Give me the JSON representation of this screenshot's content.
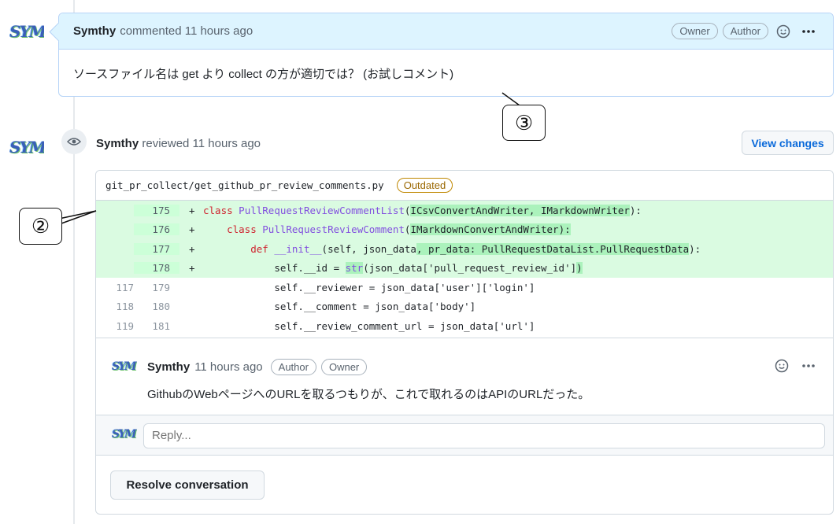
{
  "top_comment": {
    "avatar_text": "SYM",
    "author": "Symthy",
    "meta": "commented 11 hours ago",
    "badges": [
      "Owner",
      "Author"
    ],
    "body": "ソースファイル名は get より collect の方が適切では？ (お試しコメント)"
  },
  "callouts": {
    "c3": "③",
    "c2": "②"
  },
  "review": {
    "avatar_text": "SYM",
    "author": "Symthy",
    "meta": "reviewed 11 hours ago",
    "view_changes_label": "View changes"
  },
  "thread": {
    "file_path": "git_pr_collect/get_github_pr_review_comments.py",
    "outdated_label": "Outdated",
    "lines": [
      {
        "old": "",
        "new": "175",
        "sign": "+"
      },
      {
        "old": "",
        "new": "176",
        "sign": "+"
      },
      {
        "old": "",
        "new": "177",
        "sign": "+"
      },
      {
        "old": "",
        "new": "178",
        "sign": "+"
      },
      {
        "old": "117",
        "new": "179",
        "sign": ""
      },
      {
        "old": "118",
        "new": "180",
        "sign": ""
      },
      {
        "old": "119",
        "new": "181",
        "sign": ""
      }
    ],
    "code": {
      "l175_kw": "class",
      "l175_name": "PullRequestReviewCommentList",
      "l175_open": "(",
      "l175_hl": "ICsvConvertAndWriter, IMarkdownWriter",
      "l175_close": "):",
      "l176_kw": "class",
      "l176_name": "PullRequestReviewComment",
      "l176_open": "(",
      "l176_hl": "IMarkdownConvertAndWriter):",
      "l177_kw": "def",
      "l177_name": "__init__",
      "l177_args": "(self, json_data",
      "l177_hl": ", pr_data: PullRequestDataList.PullRequestData",
      "l177_close": "):",
      "l178_pre": "self.__id = ",
      "l178_hl1": "str",
      "l178_mid": "(json_data['pull_request_review_id']",
      "l178_hl2": ")",
      "l179": "self.__reviewer = json_data['user']['login']",
      "l180": "self.__comment = json_data['body']",
      "l181": "self.__review_comment_url = json_data['url']"
    },
    "reply_comment": {
      "avatar_text": "SYM",
      "author": "Symthy",
      "meta": "11 hours ago",
      "badges": [
        "Author",
        "Owner"
      ],
      "body": "GithubのWebページへのURLを取るつもりが、これで取れるのはAPIのURLだった。"
    },
    "reply_avatar_text": "SYM",
    "reply_placeholder": "Reply...",
    "resolve_label": "Resolve conversation"
  }
}
